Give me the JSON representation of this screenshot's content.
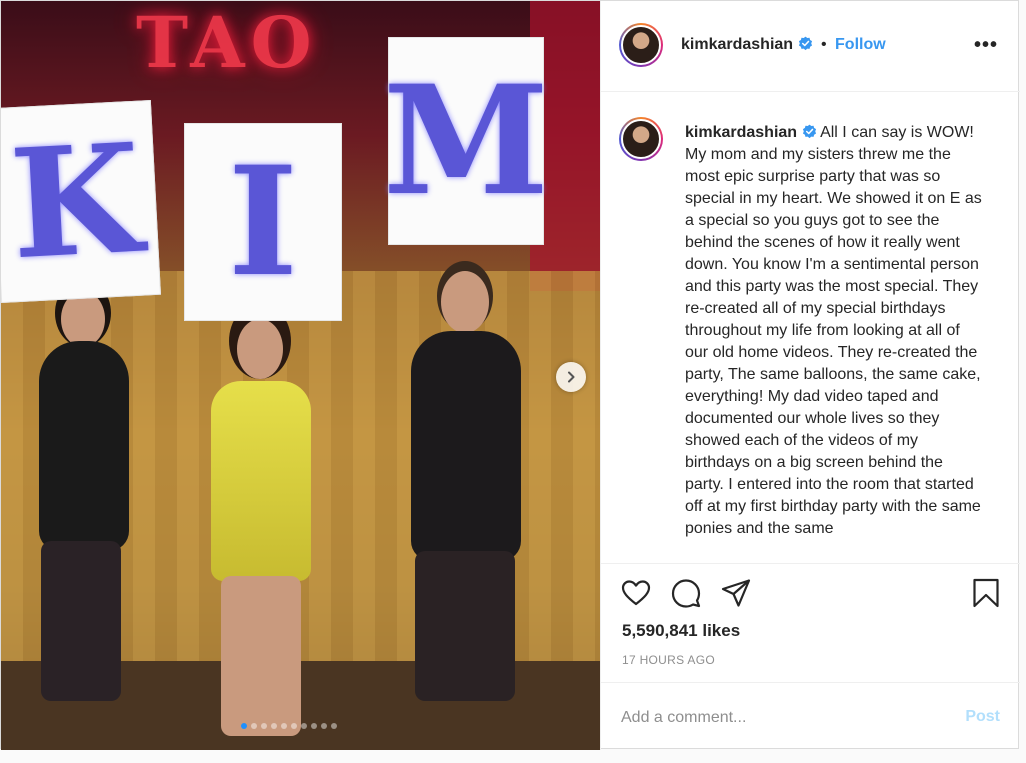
{
  "post": {
    "photo": {
      "neon_sign": "TAO",
      "sign_letters": [
        "K",
        "I",
        "M"
      ],
      "carousel_count": 10,
      "carousel_active_index": 0
    },
    "header": {
      "username": "kimkardashian",
      "separator": "•",
      "follow_label": "Follow",
      "more_label": "•••"
    },
    "caption": {
      "username": "kimkardashian",
      "text": "All I can say is WOW! My mom and my sisters threw me the most epic surprise party that was so special in my heart. We showed it on E as a special so you guys got to see the behind the scenes of how it really went down. You know I'm a sentimental person and this party was the most special. They re-created all of my special birthdays throughout my life from looking at all of our old home videos. They re-created the party, The same balloons, the same cake, everything! My dad video taped and documented our whole lives so they showed each of the videos of my birthdays on a big screen behind the party. I entered into the room that started off at my first birthday party with the same ponies and the same"
    },
    "stats": {
      "likes": "5,590,841 likes",
      "posted": "17 HOURS AGO"
    },
    "comment": {
      "placeholder": "Add a comment...",
      "post_label": "Post"
    },
    "icons": [
      "heart-icon",
      "comment-icon",
      "share-icon",
      "bookmark-icon",
      "verified-icon",
      "chevron-right-icon"
    ],
    "colors": {
      "link_blue": "#3897f0",
      "post_disabled": "#b2dffc",
      "verified": "#3897f0",
      "border": "#dbdbdb"
    }
  }
}
